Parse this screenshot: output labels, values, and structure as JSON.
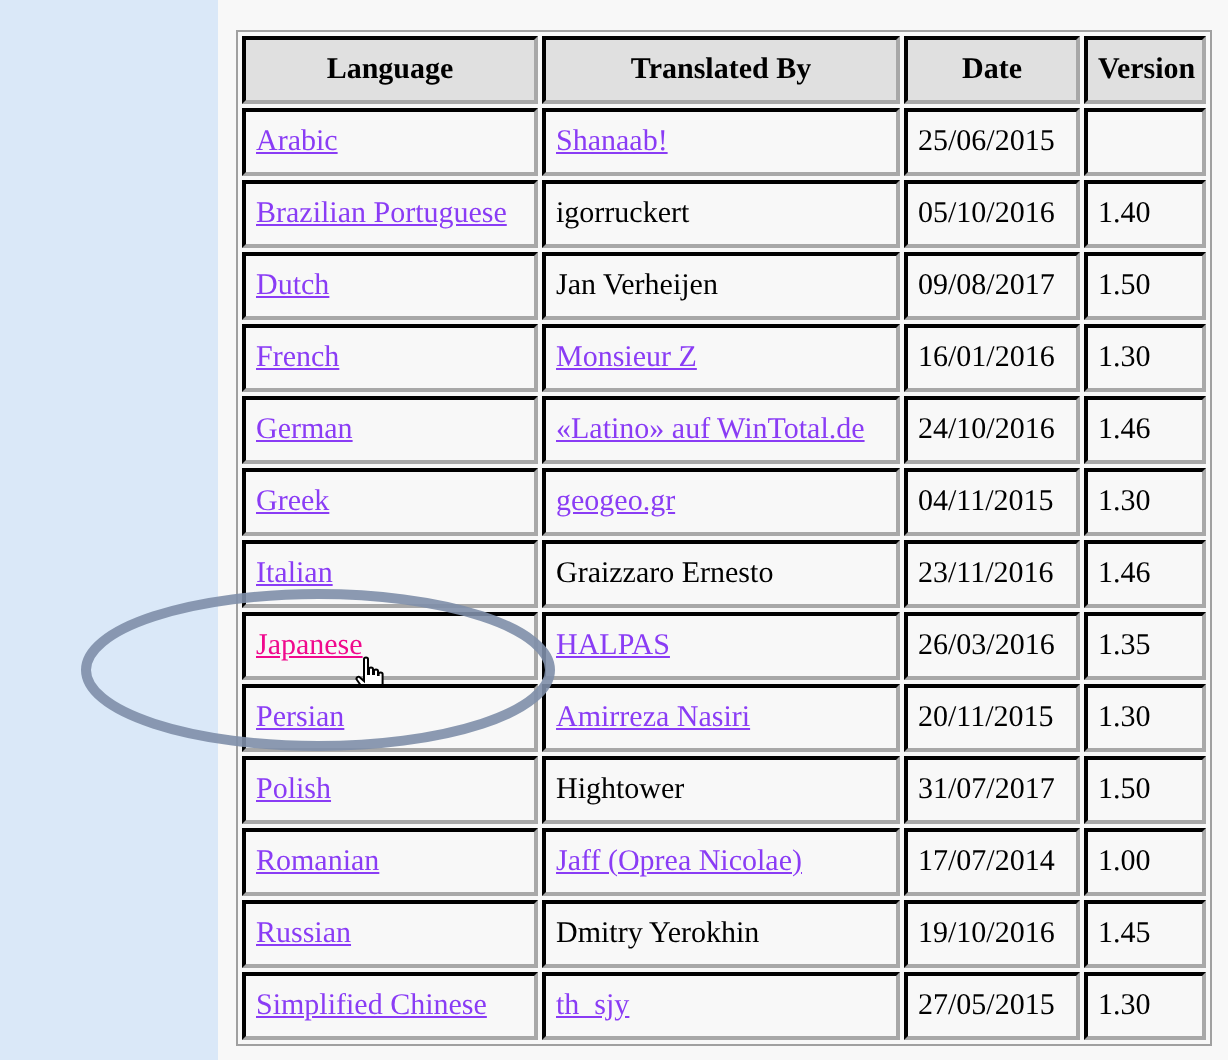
{
  "table": {
    "columns": [
      "Language",
      "Translated By",
      "Date",
      "Version"
    ],
    "rows": [
      {
        "language": {
          "text": "Arabic",
          "hovered": false
        },
        "translator": {
          "text": "Shanaab!",
          "kind": "link"
        },
        "date": "25/06/2015"
      },
      {
        "language": {
          "text": "Brazilian Portuguese",
          "hovered": false
        },
        "translator": {
          "text": "igorruckert",
          "kind": "text"
        },
        "date": "05/10/2016",
        "version": "1.40"
      },
      {
        "language": {
          "text": "Dutch",
          "hovered": false
        },
        "translator": {
          "text": "Jan Verheijen",
          "kind": "text"
        },
        "date": "09/08/2017",
        "version": "1.50"
      },
      {
        "language": {
          "text": "French",
          "hovered": false
        },
        "translator": {
          "text": "Monsieur Z",
          "kind": "link"
        },
        "date": "16/01/2016",
        "version": "1.30"
      },
      {
        "language": {
          "text": "German",
          "hovered": false
        },
        "translator": {
          "text": "«Latino» auf WinTotal.de",
          "kind": "link"
        },
        "date": "24/10/2016",
        "version": "1.46"
      },
      {
        "language": {
          "text": "Greek",
          "hovered": false
        },
        "translator": {
          "text": "geogeo.gr",
          "kind": "link"
        },
        "date": "04/11/2015",
        "version": "1.30"
      },
      {
        "language": {
          "text": "Italian",
          "hovered": false
        },
        "translator": {
          "text": "Graizzaro Ernesto",
          "kind": "text"
        },
        "date": "23/11/2016",
        "version": "1.46"
      },
      {
        "language": {
          "text": "Japanese",
          "hovered": true
        },
        "translator": {
          "text": "HALPAS",
          "kind": "link"
        },
        "date": "26/03/2016",
        "version": "1.35"
      },
      {
        "language": {
          "text": "Persian",
          "hovered": false
        },
        "translator": {
          "text": "Amirreza Nasiri",
          "kind": "link"
        },
        "date": "20/11/2015",
        "version": "1.30"
      },
      {
        "language": {
          "text": "Polish",
          "hovered": false
        },
        "translator": {
          "text": "Hightower",
          "kind": "text"
        },
        "date": "31/07/2017",
        "version": "1.50"
      },
      {
        "language": {
          "text": "Romanian",
          "hovered": false
        },
        "translator": {
          "text": "Jaff (Oprea Nicolae)",
          "kind": "link"
        },
        "date": "17/07/2014",
        "version": "1.00"
      },
      {
        "language": {
          "text": "Russian",
          "hovered": false
        },
        "translator": {
          "text": "Dmitry Yerokhin",
          "kind": "text"
        },
        "date": "19/10/2016",
        "version": "1.45"
      },
      {
        "language": {
          "text": "Simplified Chinese",
          "hovered": false
        },
        "translator": {
          "text": "th_sjy",
          "kind": "link"
        },
        "date": "27/05/2015",
        "version": "1.30"
      }
    ]
  }
}
